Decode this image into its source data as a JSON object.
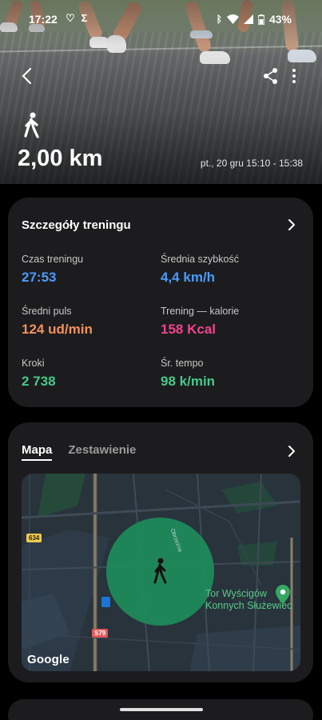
{
  "status_bar": {
    "time": "17:22",
    "battery": "43%"
  },
  "hero": {
    "distance": "2,00 km",
    "datetime": "pt., 20 gru 15:10 - 15:38"
  },
  "details": {
    "title": "Szczegóły treningu",
    "stats": [
      {
        "label": "Czas treningu",
        "value": "27:53",
        "unit": "",
        "color": "#4a9bff"
      },
      {
        "label": "Średnia szybkość",
        "value": "4,4",
        "unit": "km/h",
        "color": "#4a9bff"
      },
      {
        "label": "Średni puls",
        "value": "124",
        "unit": "ud/min",
        "color": "#f2925a"
      },
      {
        "label": "Trening — kalorie",
        "value": "158",
        "unit": "Kcal",
        "color": "#f0428f"
      },
      {
        "label": "Kroki",
        "value": "2 738",
        "unit": "",
        "color": "#46c98a"
      },
      {
        "label": "Śr. tempo",
        "value": "98",
        "unit": "k/min",
        "color": "#46c98a"
      }
    ]
  },
  "map_card": {
    "tabs": [
      "Mapa",
      "Zestawienie"
    ],
    "active_tab": "Mapa",
    "poi_name": "Tor Wyścigów\nKonnych Służewiec",
    "street_name": "Obrzeżna",
    "road_badge_1": "634",
    "road_badge_2": "S79",
    "attribution": "Google"
  }
}
